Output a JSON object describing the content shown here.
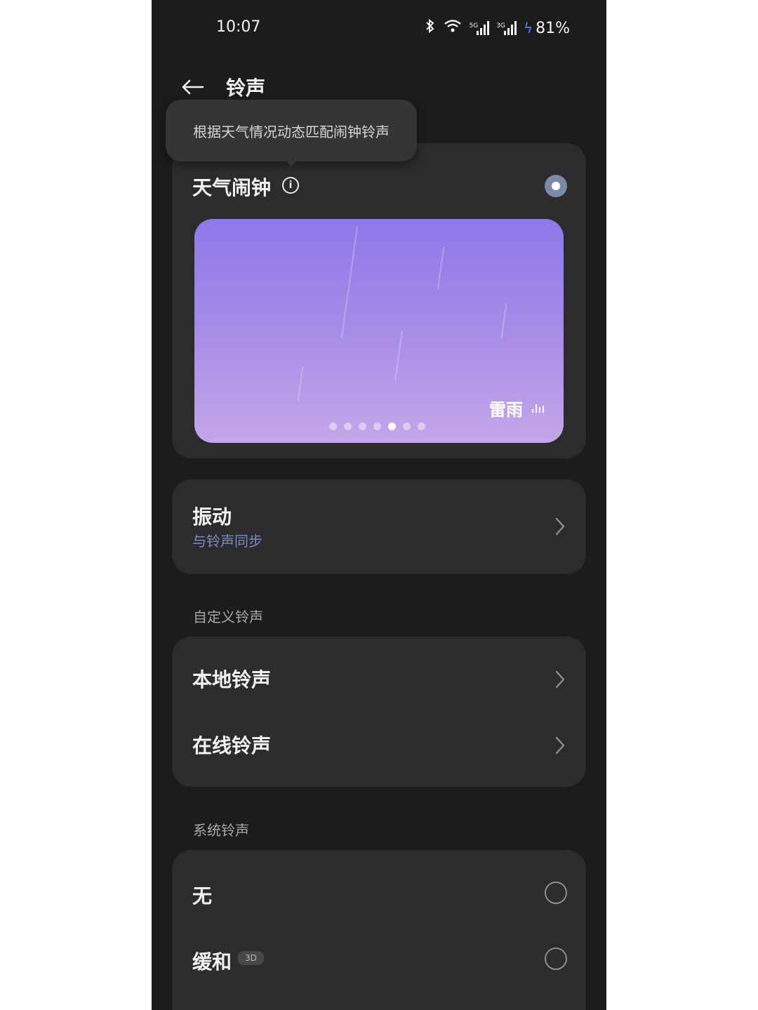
{
  "status": {
    "time": "10:07",
    "net1": "5G",
    "net2": "3G",
    "battery": "81%"
  },
  "header": {
    "title": "铃声"
  },
  "tooltip": {
    "text": "根据天气情况动态匹配闹钟铃声"
  },
  "weather_alarm": {
    "title": "天气闹钟",
    "selected": true,
    "banner_label": "雷雨",
    "page_index": 5,
    "page_count": 7
  },
  "vibration": {
    "title": "振动",
    "subtitle": "与铃声同步"
  },
  "custom": {
    "section_label": "自定义铃声",
    "items": [
      {
        "label": "本地铃声"
      },
      {
        "label": "在线铃声"
      }
    ]
  },
  "system": {
    "section_label": "系统铃声",
    "items": [
      {
        "label": "无",
        "selected": false
      },
      {
        "label": "缓和",
        "badge": "3D",
        "selected": false
      }
    ]
  },
  "colors": {
    "background": "#1c1c1e",
    "card": "#2c2c2e",
    "accent": "#7d8cc4",
    "banner_top": "#8f78ea",
    "banner_bottom": "#c4a6e8"
  }
}
